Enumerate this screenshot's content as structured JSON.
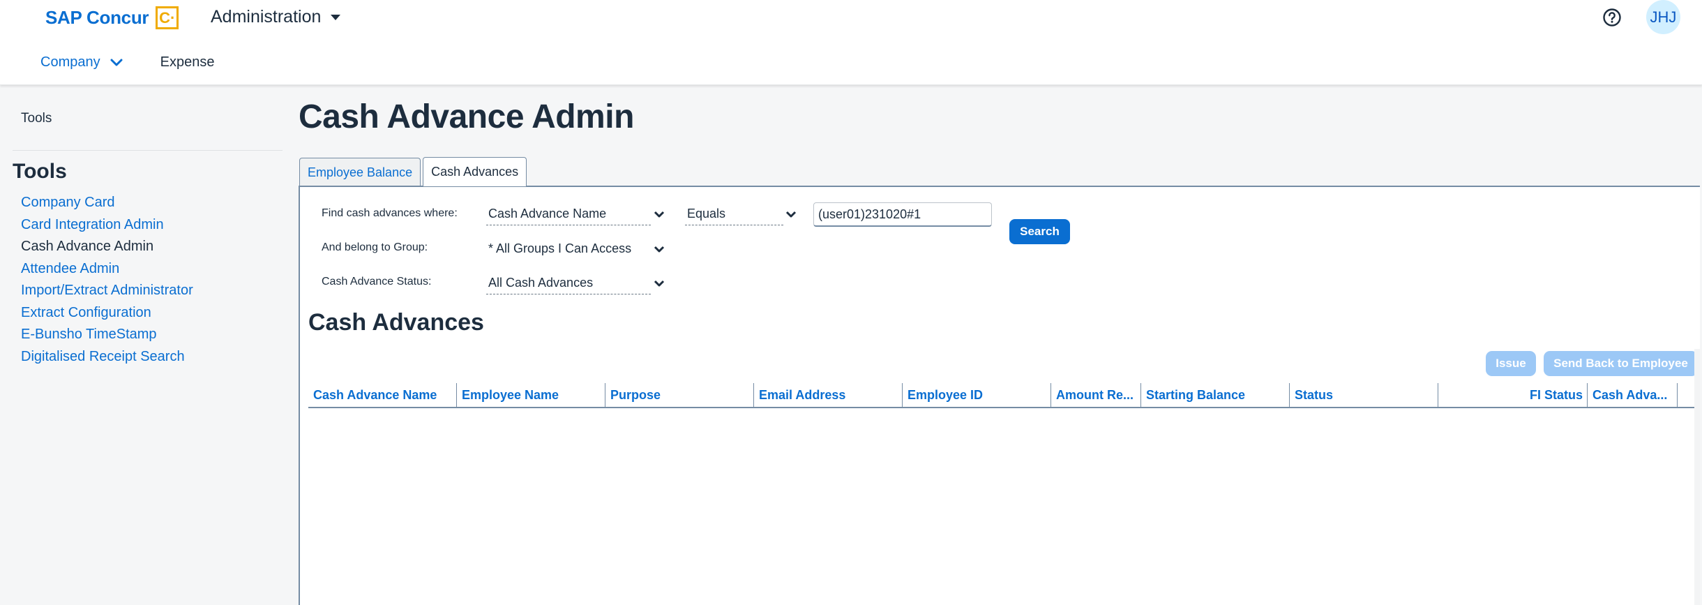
{
  "header": {
    "brand_name": "SAP Concur",
    "brand_logo_glyph": "C·",
    "app_title": "Administration",
    "help_icon": "help-circle-icon",
    "user_initials": "JHJ",
    "nav": [
      {
        "label": "Company",
        "has_dropdown": true,
        "active": true
      },
      {
        "label": "Expense",
        "has_dropdown": false,
        "active": false
      }
    ]
  },
  "sidebar": {
    "top_label": "Tools",
    "heading": "Tools",
    "items": [
      {
        "label": "Company Card",
        "active": false
      },
      {
        "label": "Card Integration Admin",
        "active": false
      },
      {
        "label": "Cash Advance Admin",
        "active": true
      },
      {
        "label": "Attendee Admin",
        "active": false
      },
      {
        "label": "Import/Extract Administrator",
        "active": false
      },
      {
        "label": "Extract Configuration",
        "active": false
      },
      {
        "label": "E-Bunsho TimeStamp",
        "active": false
      },
      {
        "label": "Digitalised Receipt Search",
        "active": false
      }
    ]
  },
  "main": {
    "page_title": "Cash Advance Admin",
    "tabs": [
      {
        "label": "Employee Balance",
        "active": false
      },
      {
        "label": "Cash Advances",
        "active": true
      }
    ],
    "filters": {
      "find_label": "Find cash advances where:",
      "field_select": "Cash Advance Name",
      "operator_select": "Equals",
      "search_value": "(user01)231020#1",
      "group_label": "And belong to Group:",
      "group_select": "* All Groups I Can Access",
      "status_label": "Cash Advance Status:",
      "status_select": "All Cash Advances",
      "search_button": "Search"
    },
    "section_title": "Cash Advances",
    "actions": {
      "issue": "Issue",
      "send_back": "Send Back to Employee"
    },
    "table": {
      "columns": [
        "Cash Advance Name",
        "Employee Name",
        "Purpose",
        "Email Address",
        "Employee ID",
        "Amount Re...",
        "Starting Balance",
        "Status",
        "FI Status",
        "Cash Adva..."
      ],
      "rows": []
    }
  },
  "colors": {
    "brand_blue": "#0a6ed1",
    "brand_logo": "#f0ab00",
    "text_dark": "#1d2d3e",
    "disabled_button": "#9cc8f6",
    "avatar_bg": "#d1efff"
  }
}
